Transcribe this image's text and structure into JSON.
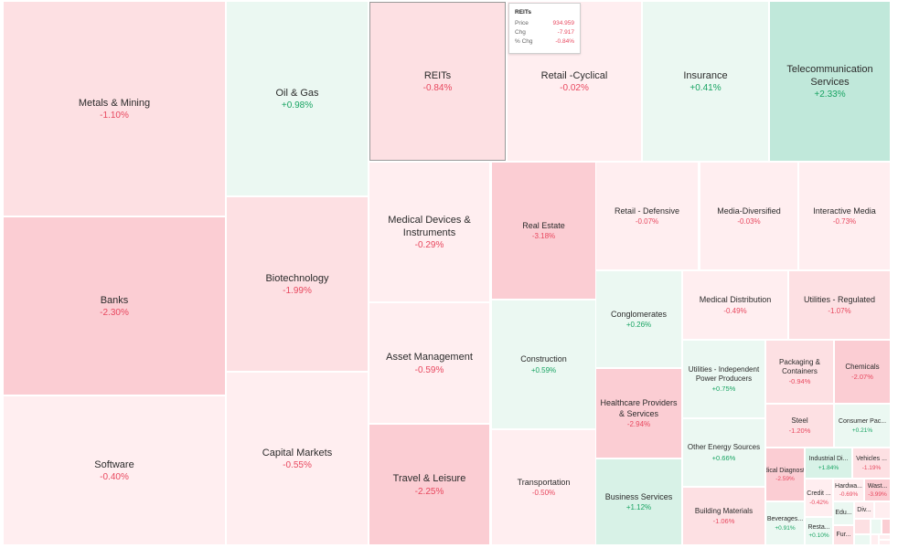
{
  "chart_data": {
    "type": "treemap",
    "title": "",
    "metric": "% Chg",
    "colors": {
      "neg_strong": "#fbcdd3",
      "neg_mid": "#fde0e3",
      "neg_light": "#ffeef0",
      "pos_light": "#ebf8f2",
      "pos_mid": "#d8f2e7",
      "pos_strong": "#c0e8da",
      "neg_text": "#e8485f",
      "pos_text": "#19a463"
    },
    "sectors": [
      {
        "name": "Metals & Mining",
        "label": "Metals & Mining",
        "change": -1.1
      },
      {
        "name": "Banks",
        "label": "Banks",
        "change": -2.3
      },
      {
        "name": "Software",
        "label": "Software",
        "change": -0.4
      },
      {
        "name": "Oil & Gas",
        "label": "Oil & Gas",
        "change": 0.98
      },
      {
        "name": "Biotechnology",
        "label": "Biotechnology",
        "change": -1.99
      },
      {
        "name": "Capital Markets",
        "label": "Capital Markets",
        "change": -0.55
      },
      {
        "name": "REITs",
        "label": "REITs",
        "change": -0.84
      },
      {
        "name": "Retail -Cyclical",
        "label": "Retail -Cyclical",
        "change": -0.02
      },
      {
        "name": "Insurance",
        "label": "Insurance",
        "change": 0.41
      },
      {
        "name": "Telecommunication Services",
        "label": "Telecommunication Services",
        "change": 2.33
      },
      {
        "name": "Medical Devices & Instruments",
        "label": "Medical Devices & Instruments",
        "change": -0.29
      },
      {
        "name": "Real Estate",
        "label": "Real Estate",
        "change": -3.18
      },
      {
        "name": "Retail - Defensive",
        "label": "Retail - Defensive",
        "change": -0.07
      },
      {
        "name": "Media-Diversified",
        "label": "Media-Diversified",
        "change": -0.03
      },
      {
        "name": "Interactive Media",
        "label": "Interactive Media",
        "change": -0.73
      },
      {
        "name": "Asset Management",
        "label": "Asset Management",
        "change": -0.59
      },
      {
        "name": "Construction",
        "label": "Construction",
        "change": 0.59
      },
      {
        "name": "Conglomerates",
        "label": "Conglomerates",
        "change": 0.26
      },
      {
        "name": "Medical Distribution",
        "label": "Medical Distribution",
        "change": -0.49
      },
      {
        "name": "Utilities - Regulated",
        "label": "Utilities - Regulated",
        "change": -1.07
      },
      {
        "name": "Travel & Leisure",
        "label": "Travel & Leisure",
        "change": -2.25
      },
      {
        "name": "Transportation",
        "label": "Transportation",
        "change": -0.5
      },
      {
        "name": "Healthcare Providers & Services",
        "label": "Healthcare Providers & Services",
        "change": -2.94
      },
      {
        "name": "Business Services",
        "label": "Business Services",
        "change": 1.12
      },
      {
        "name": "Utilities - Independent Power Producers",
        "label": "Utilities - Independent Power Producers",
        "change": 0.75
      },
      {
        "name": "Other Energy Sources",
        "label": "Other Energy Sources",
        "change": 0.66
      },
      {
        "name": "Building Materials",
        "label": "Building Materials",
        "change": -1.06
      },
      {
        "name": "Packaging & Containers",
        "label": "Packaging & Containers",
        "change": -0.94
      },
      {
        "name": "Chemicals",
        "label": "Chemicals",
        "change": -2.07
      },
      {
        "name": "Steel",
        "label": "Steel",
        "change": -1.2
      },
      {
        "name": "Consumer Packaged Goods",
        "label": "Consumer Pac...",
        "change": 0.21
      },
      {
        "name": "Medical Diagnostics",
        "label": "Medical Diagnostic...",
        "change": -2.59
      },
      {
        "name": "Beverages",
        "label": "Beverages...",
        "change": 0.91
      },
      {
        "name": "Industrial Distribution",
        "label": "Industrial Di...",
        "change": 1.84
      },
      {
        "name": "Vehicles",
        "label": "Vehicles ...",
        "change": -1.19
      },
      {
        "name": "Credit Services",
        "label": "Credit ...",
        "change": -0.42
      },
      {
        "name": "Hardware",
        "label": "Hardwa...",
        "change": -0.69
      },
      {
        "name": "Waste Management",
        "label": "Wast...",
        "change": -3.99
      },
      {
        "name": "Restaurants",
        "label": "Resta...",
        "change": 0.1
      },
      {
        "name": "Education",
        "label": "Edu...",
        "change": null
      },
      {
        "name": "Diversified",
        "label": "Div...",
        "change": null
      },
      {
        "name": "Furnishings",
        "label": "Fur...",
        "change": null
      },
      {
        "name": "unlabeled-1",
        "label": "",
        "change": null,
        "tone": "neg_light"
      },
      {
        "name": "unlabeled-2",
        "label": "",
        "change": null,
        "tone": "neg_mid"
      },
      {
        "name": "unlabeled-3",
        "label": "",
        "change": null,
        "tone": "pos_light"
      },
      {
        "name": "unlabeled-4",
        "label": "",
        "change": null,
        "tone": "neg_strong"
      },
      {
        "name": "unlabeled-5",
        "label": "",
        "change": null,
        "tone": "pos_light"
      },
      {
        "name": "unlabeled-6",
        "label": "",
        "change": null,
        "tone": "neg_light"
      },
      {
        "name": "unlabeled-7",
        "label": "",
        "change": null,
        "tone": "neg_light"
      },
      {
        "name": "unlabeled-8",
        "label": "",
        "change": null,
        "tone": "neg_light"
      }
    ]
  },
  "tooltip": {
    "title": "REITs",
    "rows": [
      {
        "label": "Price",
        "value": "934.959"
      },
      {
        "label": "Chg",
        "value": "-7.917"
      },
      {
        "label": "% Chg",
        "value": "-0.84%"
      }
    ]
  },
  "hovered": "REITs",
  "tone_for_unlabeled": {
    "Education": "pos_light",
    "Diversified": "neg_light",
    "Furnishings": "neg_mid"
  }
}
